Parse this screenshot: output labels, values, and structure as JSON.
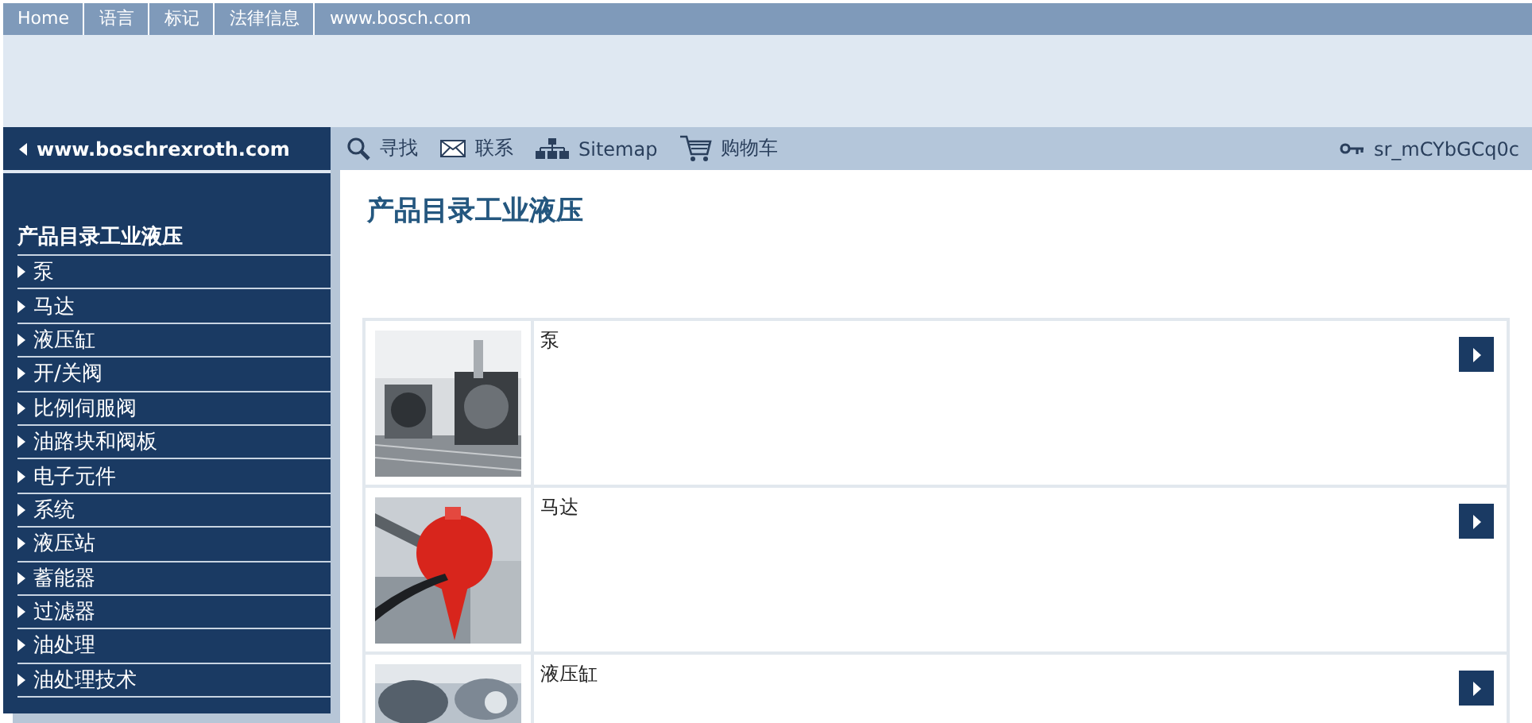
{
  "top_nav": {
    "items": [
      "Home",
      "语言",
      "标记",
      "法律信息"
    ],
    "site_link": "www.bosch.com"
  },
  "sidebar": {
    "back_link": "www.boschrexroth.com",
    "heading": "产品目录工业液压",
    "items": [
      {
        "label": "泵"
      },
      {
        "label": "马达"
      },
      {
        "label": "液压缸"
      },
      {
        "label": "开/关阀"
      },
      {
        "label": "比例伺服阀"
      },
      {
        "label": "油路块和阀板"
      },
      {
        "label": "电子元件"
      },
      {
        "label": "系统"
      },
      {
        "label": "液压站"
      },
      {
        "label": "蓄能器"
      },
      {
        "label": "过滤器"
      },
      {
        "label": "油处理"
      },
      {
        "label": "油处理技术"
      }
    ]
  },
  "toolbar": {
    "items": [
      {
        "kind": "search",
        "label": "寻找"
      },
      {
        "kind": "contact",
        "label": "联系"
      },
      {
        "kind": "sitemap",
        "label": "Sitemap"
      },
      {
        "kind": "cart",
        "label": "购物车"
      }
    ],
    "user": "sr_mCYbGCq0c"
  },
  "page_title": "产品目录工业液压",
  "products": [
    {
      "name": "泵"
    },
    {
      "name": "马达"
    },
    {
      "name": "液压缸"
    }
  ]
}
